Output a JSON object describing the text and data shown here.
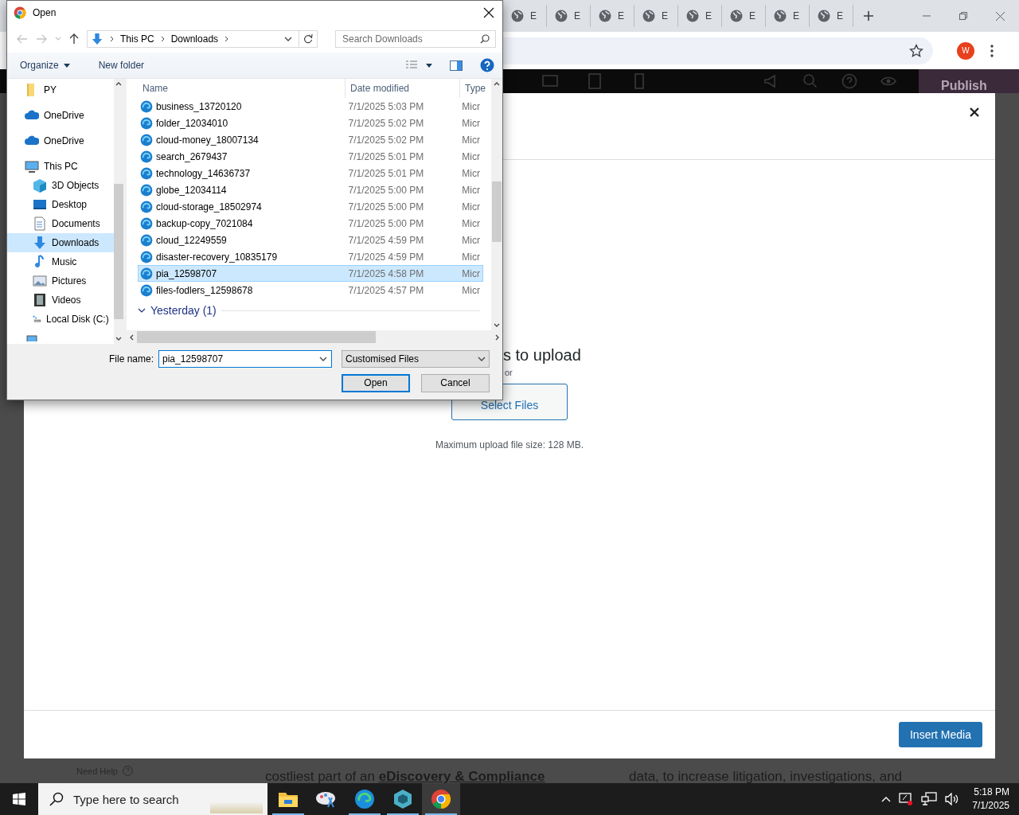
{
  "browser": {
    "tabs": [
      {
        "label": "E"
      },
      {
        "label": "E"
      },
      {
        "label": "E"
      },
      {
        "label": "E"
      },
      {
        "label": "E"
      },
      {
        "label": "E"
      },
      {
        "label": "E"
      },
      {
        "label": "E"
      }
    ],
    "profile": "W",
    "editor_bar": {
      "publish": "Publish"
    },
    "page": {
      "need_help": "Need Help",
      "text_lines": [
        "costliest part of an **eDiscovery & Compliance**",
        "data, to increase litigation, investigations, and"
      ]
    }
  },
  "media_modal": {
    "heading": "s to upload",
    "or": "or",
    "select_button": "Select Files",
    "max_size": "Maximum upload file size: 128 MB.",
    "insert_button": "Insert Media"
  },
  "open_dialog": {
    "title": "Open",
    "breadcrumb": [
      "This PC",
      "Downloads"
    ],
    "search": {
      "placeholder": "Search Downloads"
    },
    "toolbar": [
      "Organize",
      "New folder"
    ],
    "nav": [
      {
        "label": "PY",
        "kind": "folder",
        "selected": false
      },
      {
        "label": "OneDrive",
        "kind": "cloud",
        "selected": false
      },
      {
        "label": "OneDrive",
        "kind": "cloud",
        "selected": false
      },
      {
        "label": "This PC",
        "kind": "pc",
        "selected": false,
        "children": [
          {
            "label": "3D Objects",
            "kind": "cube",
            "selected": false
          },
          {
            "label": "Desktop",
            "kind": "desktop",
            "selected": false
          },
          {
            "label": "Documents",
            "kind": "document",
            "selected": false
          },
          {
            "label": "Downloads",
            "kind": "download",
            "selected": true
          },
          {
            "label": "Music",
            "kind": "music",
            "selected": false
          },
          {
            "label": "Pictures",
            "kind": "pictures",
            "selected": false
          },
          {
            "label": "Videos",
            "kind": "videos",
            "selected": false
          },
          {
            "label": "Local Disk (C:)",
            "kind": "disk",
            "selected": false
          }
        ]
      }
    ],
    "columns": [
      "Name",
      "Date modified",
      "Type"
    ],
    "files": [
      {
        "name": "business_13720120",
        "date": "7/1/2025 5:03 PM",
        "type": "Micr",
        "selected": false
      },
      {
        "name": "folder_12034010",
        "date": "7/1/2025 5:02 PM",
        "type": "Micr",
        "selected": false
      },
      {
        "name": "cloud-money_18007134",
        "date": "7/1/2025 5:02 PM",
        "type": "Micr",
        "selected": false
      },
      {
        "name": "search_2679437",
        "date": "7/1/2025 5:01 PM",
        "type": "Micr",
        "selected": false
      },
      {
        "name": "technology_14636737",
        "date": "7/1/2025 5:01 PM",
        "type": "Micr",
        "selected": false
      },
      {
        "name": "globe_12034114",
        "date": "7/1/2025 5:00 PM",
        "type": "Micr",
        "selected": false
      },
      {
        "name": "cloud-storage_18502974",
        "date": "7/1/2025 5:00 PM",
        "type": "Micr",
        "selected": false
      },
      {
        "name": "backup-copy_7021084",
        "date": "7/1/2025 5:00 PM",
        "type": "Micr",
        "selected": false
      },
      {
        "name": "cloud_12249559",
        "date": "7/1/2025 4:59 PM",
        "type": "Micr",
        "selected": false
      },
      {
        "name": "disaster-recovery_10835179",
        "date": "7/1/2025 4:59 PM",
        "type": "Micr",
        "selected": false
      },
      {
        "name": "pia_12598707",
        "date": "7/1/2025 4:58 PM",
        "type": "Micr",
        "selected": true
      },
      {
        "name": "files-fodlers_12598678",
        "date": "7/1/2025 4:57 PM",
        "type": "Micr",
        "selected": false
      }
    ],
    "groups": [
      {
        "label": "Yesterday (1)",
        "expanded": true
      }
    ],
    "file_name": {
      "label": "File name:",
      "value": "pia_12598707"
    },
    "file_type": "Customised Files",
    "buttons": [
      "Open",
      "Cancel"
    ]
  },
  "taskbar": {
    "search": {
      "placeholder": "Type here to search"
    },
    "apps": [
      {
        "kind": "explorer",
        "running": true,
        "selected": false
      },
      {
        "kind": "paint",
        "running": false,
        "selected": false
      },
      {
        "kind": "edge",
        "running": true,
        "selected": false
      },
      {
        "kind": "hexagon",
        "running": true,
        "selected": false
      },
      {
        "kind": "chrome",
        "running": true,
        "selected": true
      }
    ],
    "time": "5:18 PM",
    "date": "7/1/2025"
  }
}
